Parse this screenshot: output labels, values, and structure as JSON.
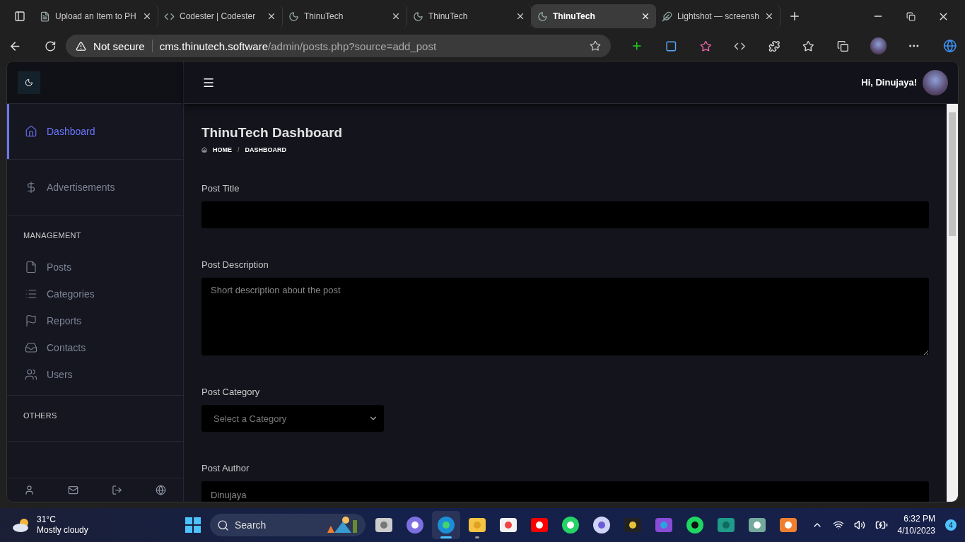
{
  "browser": {
    "tabs": [
      {
        "title": "Upload an Item to PH",
        "kind": "page",
        "selected": false
      },
      {
        "title": "Codester | Codester",
        "kind": "code",
        "selected": false
      },
      {
        "title": "ThinuTech",
        "kind": "moon",
        "selected": false
      },
      {
        "title": "ThinuTech",
        "kind": "moon",
        "selected": false
      },
      {
        "title": "ThinuTech",
        "kind": "moon",
        "selected": true
      },
      {
        "title": "Lightshot — screensh",
        "kind": "feather",
        "selected": false
      }
    ],
    "security": "Not secure",
    "url_host": "cms.thinutech.software",
    "url_path": "/admin/posts.php?source=add_post"
  },
  "sidebar": {
    "groups": [
      {
        "items": [
          {
            "label": "Dashboard",
            "kind": "home",
            "selected": true
          }
        ]
      },
      {
        "items": [
          {
            "label": "Advertisements",
            "kind": "dollar",
            "selected": false
          }
        ]
      },
      {
        "heading": "MANAGEMENT",
        "items": [
          {
            "label": "Posts",
            "kind": "file",
            "selected": false
          },
          {
            "label": "Categories",
            "kind": "list",
            "selected": false
          },
          {
            "label": "Reports",
            "kind": "flag",
            "selected": false
          },
          {
            "label": "Contacts",
            "kind": "inbox",
            "selected": false
          },
          {
            "label": "Users",
            "kind": "users",
            "selected": false
          }
        ]
      },
      {
        "heading": "OTHERS"
      }
    ]
  },
  "header": {
    "greeting": "Hi, Dinujaya!"
  },
  "page": {
    "title": "ThinuTech Dashboard",
    "breadcrumb": [
      "HOME",
      "DASHBOARD"
    ],
    "breadcrumb_separator": "/",
    "fields": [
      {
        "label": "Post Title",
        "kind": "text"
      },
      {
        "label": "Post Description",
        "kind": "textarea",
        "placeholder": "Short description about the post"
      },
      {
        "label": "Post Category",
        "kind": "select",
        "placeholder": "Select a Category"
      },
      {
        "label": "Post Author",
        "kind": "text",
        "placeholder": "Dinujaya"
      }
    ]
  },
  "taskbar": {
    "temperature": "31°C",
    "weather": "Mostly cloudy",
    "search_placeholder": "Search",
    "apps": [
      {
        "kind": "taskview",
        "selected": false
      },
      {
        "kind": "meet",
        "selected": false
      },
      {
        "kind": "edge",
        "selected": true
      },
      {
        "kind": "folder",
        "selected": false
      },
      {
        "kind": "store",
        "selected": false
      },
      {
        "kind": "youtube",
        "selected": false
      },
      {
        "kind": "whatsapp",
        "selected": false
      },
      {
        "kind": "prism",
        "selected": false
      },
      {
        "kind": "tile",
        "selected": false
      },
      {
        "kind": "jellyfin",
        "selected": false
      },
      {
        "kind": "spotify",
        "selected": false
      },
      {
        "kind": "vscode",
        "selected": false
      },
      {
        "kind": "chatgpt",
        "selected": false
      },
      {
        "kind": "xampp",
        "selected": false
      }
    ],
    "time": "6:32 PM",
    "date": "4/10/2023",
    "notifications": "4"
  }
}
